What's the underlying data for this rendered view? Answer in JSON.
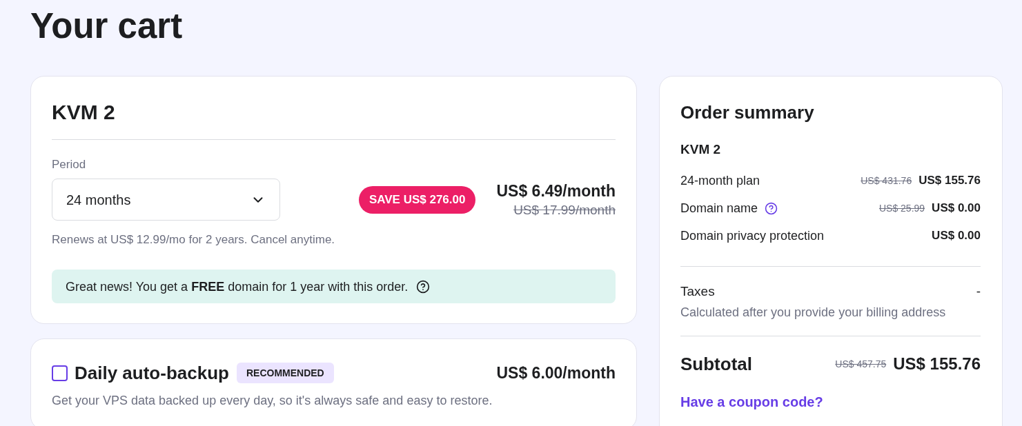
{
  "page": {
    "title": "Your cart"
  },
  "plan_card": {
    "title": "KVM 2",
    "period": {
      "label": "Period",
      "value": "24 months"
    },
    "savings_badge": "SAVE US$ 276.00",
    "price": "US$ 6.49/month",
    "old_price": "US$ 17.99/month",
    "renewal_note": "Renews at US$ 12.99/mo for 2 years. Cancel anytime.",
    "notice": "Great news! You get a **FREE** domain for 1 year with this order."
  },
  "addons": [
    {
      "title": "Daily auto-backup",
      "checked": false,
      "badge": "RECOMMENDED",
      "price": "US$ 6.00/month",
      "description": "Get your VPS data backed up every day, so it's always safe and easy to restore."
    }
  ],
  "order_summary": {
    "title": "Order summary",
    "product": "KVM 2",
    "lines": [
      {
        "label": "24-month plan",
        "has_help": false,
        "old_price": "US$ 431.76",
        "price": "US$ 155.76"
      },
      {
        "label": "Domain name",
        "has_help": true,
        "old_price": "US$ 25.99",
        "price": "US$ 0.00"
      },
      {
        "label": "Domain privacy protection",
        "has_help": false,
        "price": "US$ 0.00"
      }
    ],
    "taxes": {
      "label": "Taxes",
      "value": "-",
      "note": "Calculated after you provide your billing address"
    },
    "subtotal": {
      "label": "Subtotal",
      "old_price": "US$ 457.75",
      "price": "US$ 155.76"
    },
    "coupon_link": "Have a coupon code?"
  }
}
